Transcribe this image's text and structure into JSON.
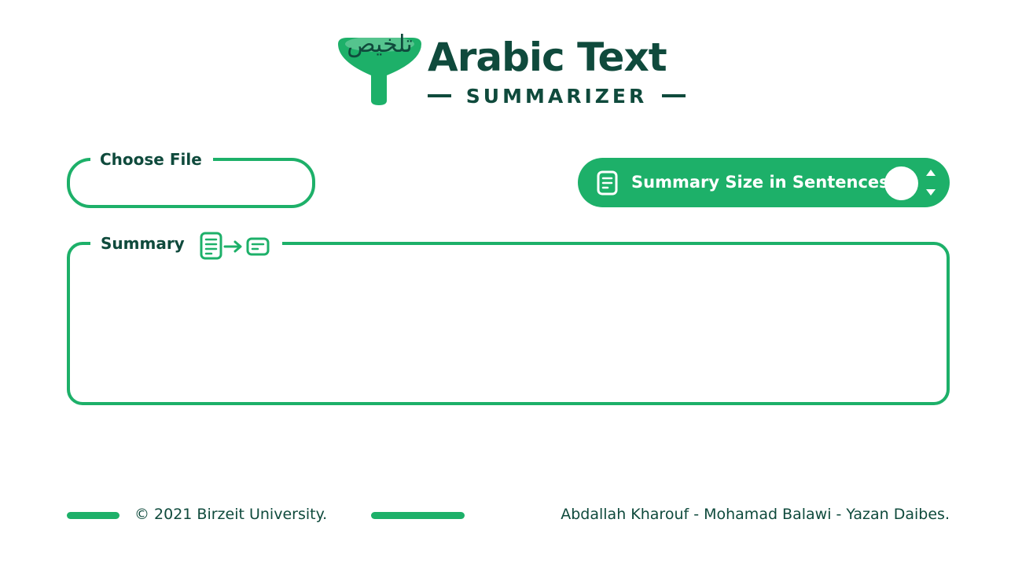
{
  "logo": {
    "arabic_text": "تلخيص",
    "title": "Arabic Text",
    "subtitle": "SUMMARIZER",
    "mark_icon": "funnel-icon"
  },
  "file_upload": {
    "label": "Choose File"
  },
  "summary_size": {
    "label": "Summary Size in Sentences",
    "value": "",
    "icon": "document-icon"
  },
  "summary": {
    "label": "Summary",
    "content": "",
    "icon": "document-to-summary-icon"
  },
  "footer": {
    "copyright": "© 2021 Birzeit University.",
    "authors": "Abdallah Kharouf - Mohamad Balawi - Yazan Daibes."
  },
  "colors": {
    "accent": "#1db069",
    "text_dark": "#0f4a3c",
    "background": "#ffffff"
  }
}
